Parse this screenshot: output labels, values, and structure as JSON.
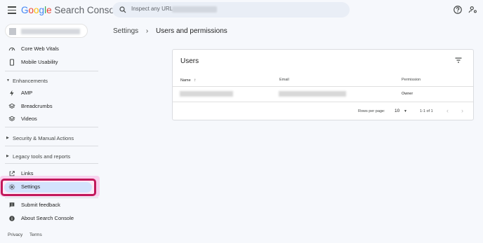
{
  "header": {
    "logo": {
      "G": "G",
      "o1": "o",
      "o2": "o",
      "g": "g",
      "l": "l",
      "e": "e",
      "product": "Search Console"
    },
    "search_placeholder": "Inspect any URL"
  },
  "sidebar": {
    "items_top": [
      {
        "label": "Core Web Vitals",
        "icon": "speedometer-icon"
      },
      {
        "label": "Mobile Usability",
        "icon": "phone-icon"
      }
    ],
    "enhancements": {
      "label": "Enhancements",
      "items": [
        {
          "label": "AMP",
          "icon": "bolt-icon"
        },
        {
          "label": "Breadcrumbs",
          "icon": "layers-icon"
        },
        {
          "label": "Videos",
          "icon": "video-icon"
        }
      ]
    },
    "security_label": "Security & Manual Actions",
    "legacy_label": "Legacy tools and reports",
    "links_label": "Links",
    "settings_label": "Settings",
    "feedback_label": "Submit feedback",
    "about_label": "About Search Console",
    "footer": {
      "privacy": "Privacy",
      "terms": "Terms"
    }
  },
  "breadcrumb": {
    "parent": "Settings",
    "current": "Users and permissions"
  },
  "users_card": {
    "title": "Users",
    "columns": {
      "name": "Name",
      "sort_arrow": "↑",
      "email": "Email",
      "permission": "Permission"
    },
    "rows": [
      {
        "permission": "Owner"
      }
    ],
    "pagination": {
      "rows_per_page_label": "Rows per page:",
      "rows_per_page": "10",
      "range": "1-1 of 1"
    }
  },
  "colors": {
    "accent": "#c2185b",
    "selected_bg": "#d3e3fd",
    "page_bg": "#f6f8fc"
  }
}
